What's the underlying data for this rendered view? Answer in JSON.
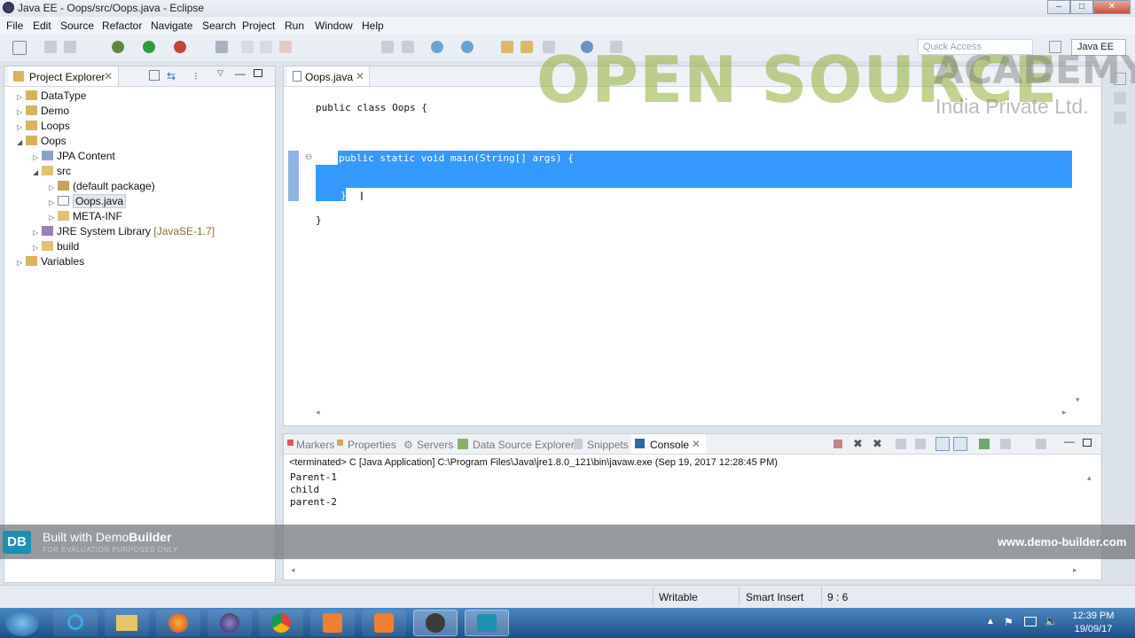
{
  "window": {
    "title": "Java EE - Oops/src/Oops.java - Eclipse",
    "minimize": "–",
    "maximize": "□",
    "close": "✕"
  },
  "menu": [
    "File",
    "Edit",
    "Source",
    "Refactor",
    "Navigate",
    "Search",
    "Project",
    "Run",
    "Window",
    "Help"
  ],
  "toolbar": {
    "quick_access_placeholder": "Quick Access",
    "perspective_label": "Java EE"
  },
  "explorer": {
    "tab_label": "Project Explorer",
    "items": [
      {
        "label": "DataType"
      },
      {
        "label": "Demo"
      },
      {
        "label": "Loops"
      },
      {
        "label": "Oops"
      },
      {
        "label": "JPA Content"
      },
      {
        "label": "src"
      },
      {
        "label": "(default package)"
      },
      {
        "label": "Oops.java"
      },
      {
        "label": "META-INF"
      },
      {
        "label": "JRE System Library",
        "suffix": "[JavaSE-1.7]"
      },
      {
        "label": "build"
      },
      {
        "label": "Variables"
      }
    ]
  },
  "editor": {
    "tab_label": "Oops.java",
    "lines": [
      "public class Oops {",
      "public static void main(String[] args) {",
      "}",
      "}"
    ]
  },
  "watermark": {
    "line1": "OPEN SOURCE",
    "line1b": "ACADEMY",
    "line2": "India Private Ltd."
  },
  "console": {
    "tabs": [
      "Markers",
      "Properties",
      "Servers",
      "Data Source Explorer",
      "Snippets",
      "Console"
    ],
    "header": "<terminated> C [Java Application] C:\\Program Files\\Java\\jre1.8.0_121\\bin\\javaw.exe (Sep 19, 2017 12:28:45 PM)",
    "output": [
      "Parent-1",
      "child",
      "parent-2"
    ]
  },
  "banner": {
    "built_with": "Built with ",
    "demo": "Demo",
    "builder": "Builder",
    "eval": "FOR EVALUATION PURPOSES ONLY",
    "logo": "DB",
    "url": "www.demo-builder.com"
  },
  "status": {
    "writable": "Writable",
    "insert_mode": "Smart Insert",
    "position": "9 : 6"
  },
  "taskbar": {
    "time": "12:39 PM",
    "date": "19/09/17"
  },
  "colors": {
    "selection": "#3399ff",
    "keyword": "#7f0055",
    "watermark_green": "#8fae34"
  }
}
